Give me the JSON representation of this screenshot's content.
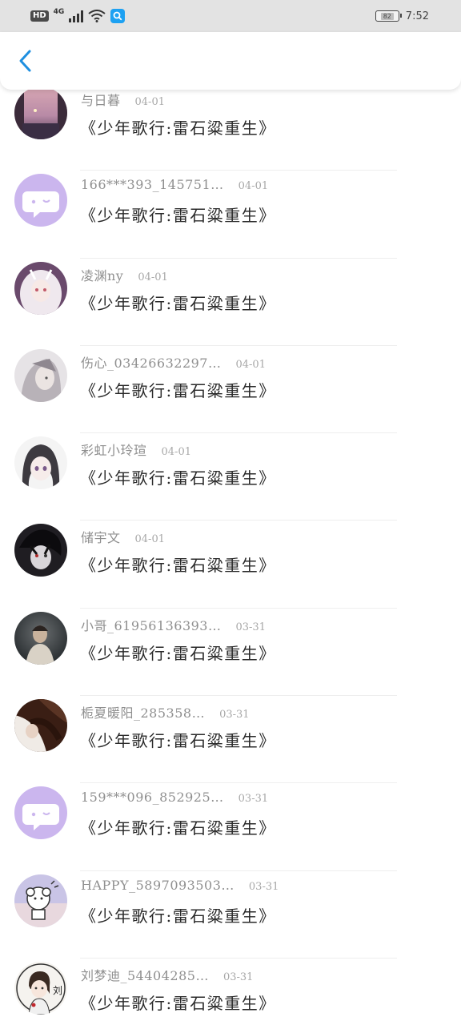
{
  "status_bar": {
    "hd": "HD",
    "network": "4G",
    "battery": "82",
    "time": "7:52"
  },
  "header": {
    "back_icon": "chevron-left-icon"
  },
  "items": [
    {
      "username": "与日暮",
      "date": "04-01",
      "comment": "《少年歌行:雷石粱重生》",
      "avatar": "photo-sunset"
    },
    {
      "username": "166***393_145751…",
      "date": "04-01",
      "comment": "《少年歌行:雷石粱重生》",
      "avatar": "default-chat"
    },
    {
      "username": "凌渊ny",
      "date": "04-01",
      "comment": "《少年歌行:雷石粱重生》",
      "avatar": "anime-white-hair"
    },
    {
      "username": "伤心_03426632297…",
      "date": "04-01",
      "comment": "《少年歌行:雷石粱重生》",
      "avatar": "anime-gray"
    },
    {
      "username": "彩虹小玲瑄",
      "date": "04-01",
      "comment": "《少年歌行:雷石粱重生》",
      "avatar": "anime-girl"
    },
    {
      "username": "储宇文",
      "date": "04-01",
      "comment": "《少年歌行:雷石粱重生》",
      "avatar": "anime-dark"
    },
    {
      "username": "小哥_61956136393…",
      "date": "03-31",
      "comment": "《少年歌行:雷石粱重生》",
      "avatar": "photo-person"
    },
    {
      "username": "栀夏暖阳_285358…",
      "date": "03-31",
      "comment": "《少年歌行:雷石粱重生》",
      "avatar": "photo-hair"
    },
    {
      "username": "159***096_852925…",
      "date": "03-31",
      "comment": "《少年歌行:雷石粱重生》",
      "avatar": "default-chat"
    },
    {
      "username": "HAPPY_5897093503…",
      "date": "03-31",
      "comment": "《少年歌行:雷石粱重生》",
      "avatar": "cartoon-dog"
    },
    {
      "username": "刘梦迪_54404285…",
      "date": "03-31",
      "comment": "《少年歌行:雷石粱重生》",
      "avatar": "cartoon-girl-liu"
    }
  ],
  "avatar_labels": {
    "liu": "刘"
  },
  "colors": {
    "status_bar_bg": "#e3e3e3",
    "back_arrow": "#1e8fe0",
    "default_avatar_bg": "#cbb6ee",
    "username": "#8f8f8f",
    "comment": "#2a2a2a"
  }
}
